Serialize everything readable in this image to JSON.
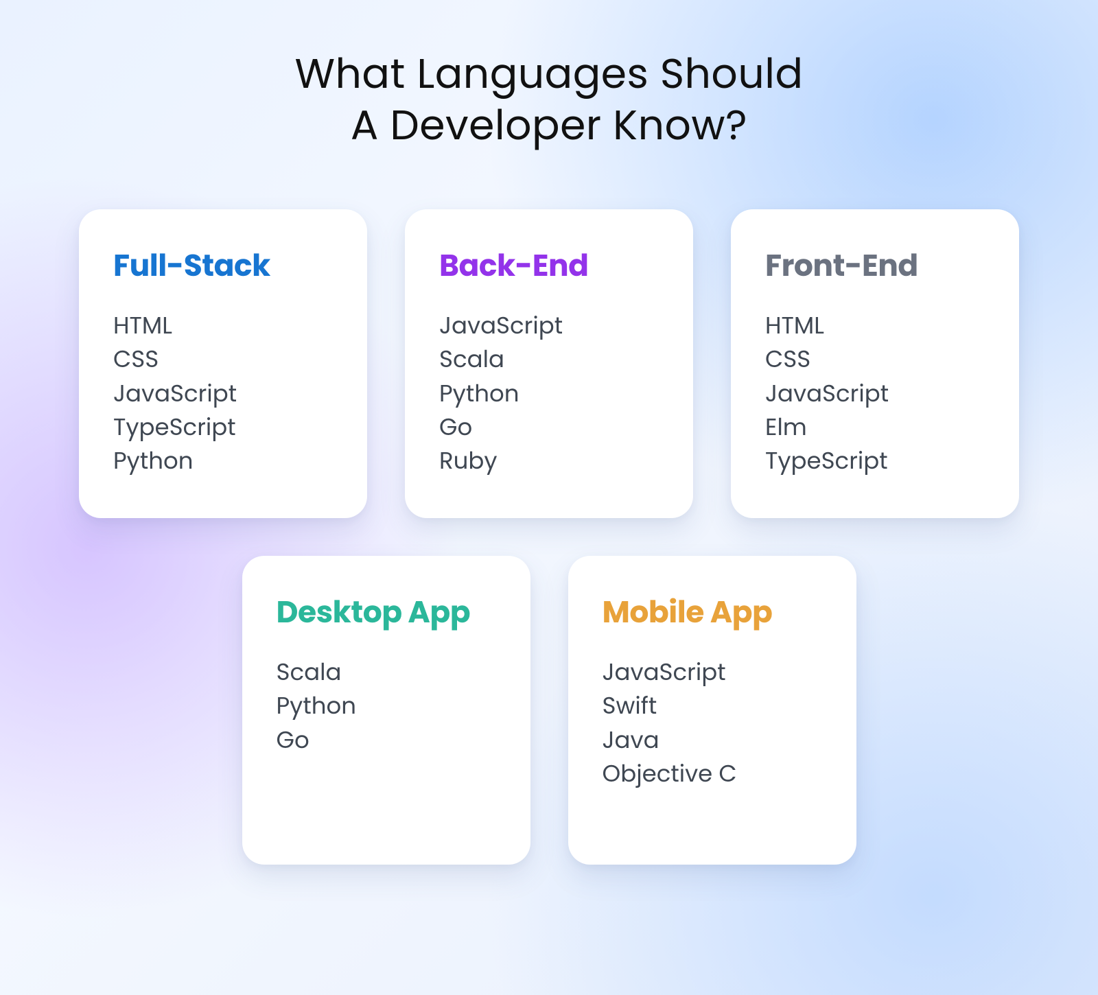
{
  "title_line1": "What Languages Should",
  "title_line2": "A Developer Know?",
  "colors": {
    "fullstack": "#1775d1",
    "backend": "#9333ea",
    "frontend": "#6b7280",
    "desktop": "#2bb79a",
    "mobile": "#e8a23a"
  },
  "cards": [
    {
      "id": "fullstack",
      "title": "Full-Stack",
      "colorKey": "fullstack",
      "items": [
        "HTML",
        "CSS",
        "JavaScript",
        "TypeScript",
        "Python"
      ]
    },
    {
      "id": "backend",
      "title": "Back-End",
      "colorKey": "backend",
      "items": [
        "JavaScript",
        "Scala",
        "Python",
        "Go",
        "Ruby"
      ]
    },
    {
      "id": "frontend",
      "title": "Front-End",
      "colorKey": "frontend",
      "items": [
        "HTML",
        "CSS",
        "JavaScript",
        "Elm",
        "TypeScript"
      ]
    },
    {
      "id": "desktop",
      "title": "Desktop App",
      "colorKey": "desktop",
      "items": [
        "Scala",
        "Python",
        "Go"
      ]
    },
    {
      "id": "mobile",
      "title": "Mobile App",
      "colorKey": "mobile",
      "items": [
        "JavaScript",
        "Swift",
        "Java",
        "Objective C"
      ]
    }
  ],
  "layout_rows": [
    [
      "fullstack",
      "backend",
      "frontend"
    ],
    [
      "desktop",
      "mobile"
    ]
  ]
}
